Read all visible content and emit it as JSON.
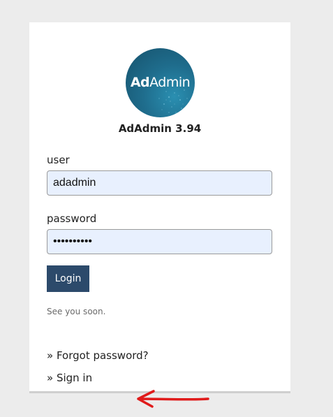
{
  "logo": {
    "text_bold": "Ad",
    "text_regular": "Admin"
  },
  "app": {
    "title": "AdAdmin 3.94"
  },
  "form": {
    "user_label": "user",
    "user_value": "adadmin",
    "password_label": "password",
    "password_value": "••••••••••",
    "login_label": "Login"
  },
  "note": "See you soon.",
  "links": {
    "forgot": "» Forgot password?",
    "signin": "» Sign in"
  },
  "annotation": {
    "arrow_color": "#e01b1b"
  },
  "colors": {
    "login_button": "#2c4a6b",
    "input_background": "#e8f0fe",
    "page_background": "#ececec"
  }
}
